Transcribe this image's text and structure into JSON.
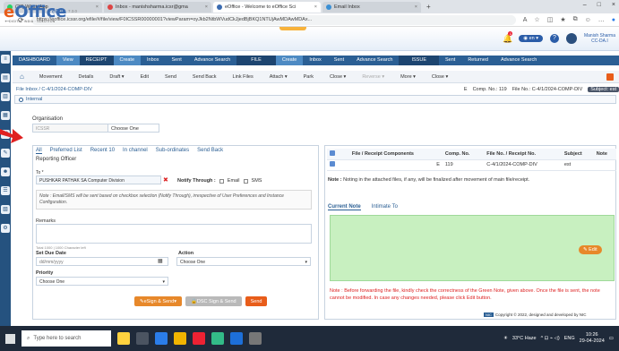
{
  "browser": {
    "tabs": [
      {
        "label": "(27) WhatsApp",
        "active": false
      },
      {
        "label": "Inbox - manishsharma.icsr@gma",
        "active": false
      },
      {
        "label": "eOffice - Welcome to eOffice Sci",
        "active": true
      },
      {
        "label": "Email Inbox",
        "active": false
      }
    ],
    "url": "https://eoffice.icssr.org/efile/#/file/view/F0ICSSR00000001?viewParam=oyJkb2NtbWVudCkJjedBjBKQ1NTUjAwMDAwMDAx...",
    "new_tab": "+"
  },
  "app": {
    "logo": "eOffice",
    "logo_sub": "eFile",
    "version": "7.3.0",
    "tagline": "DIGITAL INDIA · SOLUTION",
    "notif_count": "1",
    "lang": "en",
    "user_name": "Manish Sharma",
    "user_role": "CC-DA.I"
  },
  "topnav": {
    "items": [
      "DASHBOARD",
      "View",
      "RECEIPT",
      "Create",
      "Inbox",
      "Sent",
      "Advance Search",
      "FILE",
      "Create",
      "Inbox",
      "Sent",
      "Advance Search",
      "ISSUE",
      "Sent",
      "Returned",
      "Advance Search"
    ]
  },
  "subnav": {
    "items": [
      "Movement",
      "Details",
      "Draft",
      "Edit",
      "Send",
      "Send Back",
      "Link Files",
      "Attach",
      "Park",
      "Close",
      "Reverse",
      "More",
      "Close"
    ]
  },
  "crumb": {
    "path": "File Inbox / C-4/1/2024-COMP-DIV",
    "comp_label": "E",
    "comp_no_label": "Comp. No.: 119",
    "file_no_label": "File No.: C-4/1/2024-COMP-DIV",
    "subject_label": "Subject:",
    "subject_value": "est"
  },
  "form": {
    "internal": "Internal",
    "organisation": "Organisation",
    "org_value": "ICSSR",
    "org_select": "Choose One",
    "tabs": [
      "All",
      "Preferred List",
      "Recent 10",
      "In channel",
      "Sub-ordinates",
      "Send Back"
    ],
    "reporting": "Reporting Officer",
    "to_label": "To *",
    "to_value": "PUSHKAR PATHAK SA Computer Division",
    "notify_label": "Notify Through :",
    "email": "Email",
    "sms": "SMS",
    "note": "Note : Email/SMS will be sent based on checkbox selection (Notify Through), irrespective of User Preferences and Instance Configuration.",
    "remarks": "Remarks",
    "char_left": "Total 1000 | 1000 Character left",
    "due_label": "Set Due Date",
    "due_placeholder": "dd/mm/yyyy",
    "action_label": "Action",
    "action_value": "Choose One",
    "priority_label": "Priority",
    "priority_value": "Choose One",
    "btn_esign": "eSign & Send",
    "btn_dsc": "DSC Sign & Send",
    "btn_send": "Send"
  },
  "table": {
    "headers": [
      "File / Receipt Components",
      "Comp. No.",
      "File No. / Receipt No.",
      "Subject",
      "Note"
    ],
    "row": {
      "type": "E",
      "comp_no": "119",
      "file_no": "C-4/1/2024-COMP-DIV",
      "subject": "est"
    }
  },
  "notes": {
    "attach_note_bold": "Note :",
    "attach_note": "Noting in the attached files, if any, will be finalized after movement of main file/receipt.",
    "tab_current": "Current Note",
    "tab_intimate": "Intimate To",
    "edit": "Edit",
    "warn": "Note : Before forwarding the file, kindly check the correctness of the Green Note, given above. Once the file is sent, the note cannot be modified. In case any changes needed, please click Edit button."
  },
  "footer": {
    "nic": "NIC",
    "copyright": "Copyright © 2022, designed and developed by NIC"
  },
  "taskbar": {
    "search": "Type here to search",
    "weather": "33°C Haze",
    "lang": "ENG",
    "time": "10:26",
    "date": "29-04-2024"
  }
}
